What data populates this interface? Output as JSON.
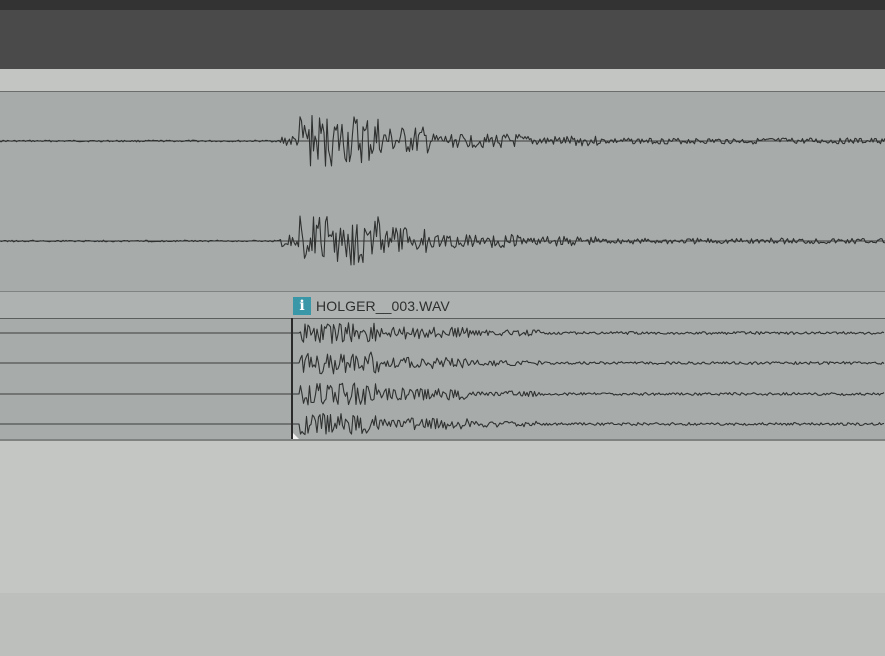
{
  "item": {
    "name": "HOLGER__003.WAV",
    "info_icon_glyph": "i",
    "info_icon_name": "info-icon",
    "info_icon_color": "#3a97a8"
  },
  "colors": {
    "toolbar": "#4a4a4a",
    "track_bg": "#a7abaa",
    "waveform": "#2f3131",
    "empty_area": "#c4c6c4"
  }
}
